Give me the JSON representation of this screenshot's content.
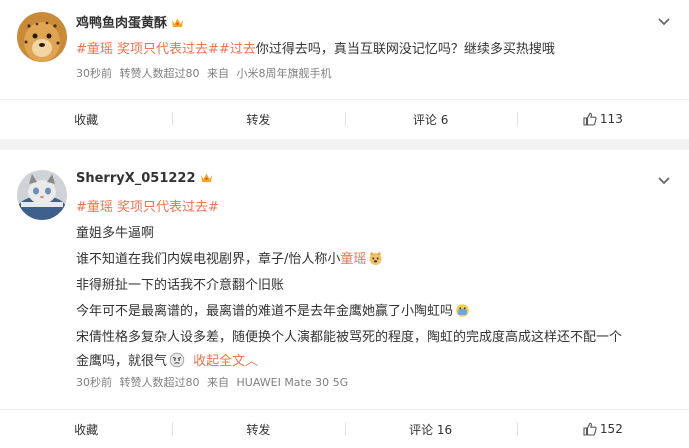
{
  "posts": [
    {
      "nickname": "鸡鸭鱼肉蛋黄酥",
      "text": {
        "tag1": "#童瑶 奖项只代表过去#",
        "tag2": "过去",
        "body": "你过得去吗，真当互联网没记忆吗？继续多买热搜哦"
      },
      "meta": {
        "time": "30秒前",
        "reposts": "转赞人数超过80",
        "source_prefix": "来自",
        "source": "小米8周年旗舰手机"
      },
      "actions": {
        "collect": "收藏",
        "repost": "转发",
        "comment": "评论 6",
        "like": "113"
      }
    },
    {
      "nickname": "SherryX_051222",
      "text": {
        "tag": "#童瑶 奖项只代表过去#",
        "line1": "童姐多牛逼啊",
        "line2_pre": "谁不知道在我们内娱电视剧界，章子/怡人称小",
        "line2_link": "童瑶",
        "line3": "非得掰扯一下的话我不介意翻个旧账",
        "line4": "今年可不是最离谱的，最离谱的难道不是去年金鹰她赢了小陶虹吗",
        "line5": "宋倩性格多复杂人设多差，随便换个人演都能被骂死的程度，陶虹的完成度高成这样还不配一个",
        "line6_pre": "金鹰吗，就很气",
        "collapse": "收起全文",
        "collapse_arrow": "︿"
      },
      "meta": {
        "time": "30秒前",
        "reposts": "转赞人数超过80",
        "source_prefix": "来自",
        "source": "HUAWEI Mate 30 5G"
      },
      "actions": {
        "collect": "收藏",
        "repost": "转发",
        "comment": "评论 16",
        "like": "152"
      }
    }
  ],
  "colors": {
    "accent": "#eb7350",
    "meta": "#808080",
    "crown": "#f5a623"
  }
}
